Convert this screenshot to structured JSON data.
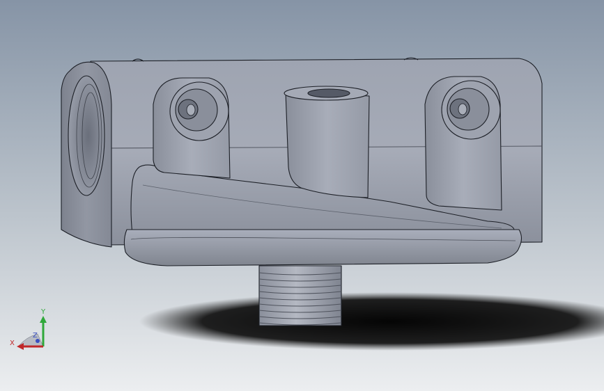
{
  "colors": {
    "bg_top": "#8a98a8",
    "bg_bottom": "#e8ebee",
    "part_light": "#a8adb8",
    "part_mid": "#8c919e",
    "part_dark": "#6e7380",
    "edge": "#1c1f26",
    "shadow": "#0c0c0c",
    "axis_x": "#c0282a",
    "axis_y": "#2fa83a",
    "axis_z": "#3a4fc0"
  },
  "triad": {
    "x_label": "X",
    "y_label": "Y",
    "z_label": "Z"
  }
}
